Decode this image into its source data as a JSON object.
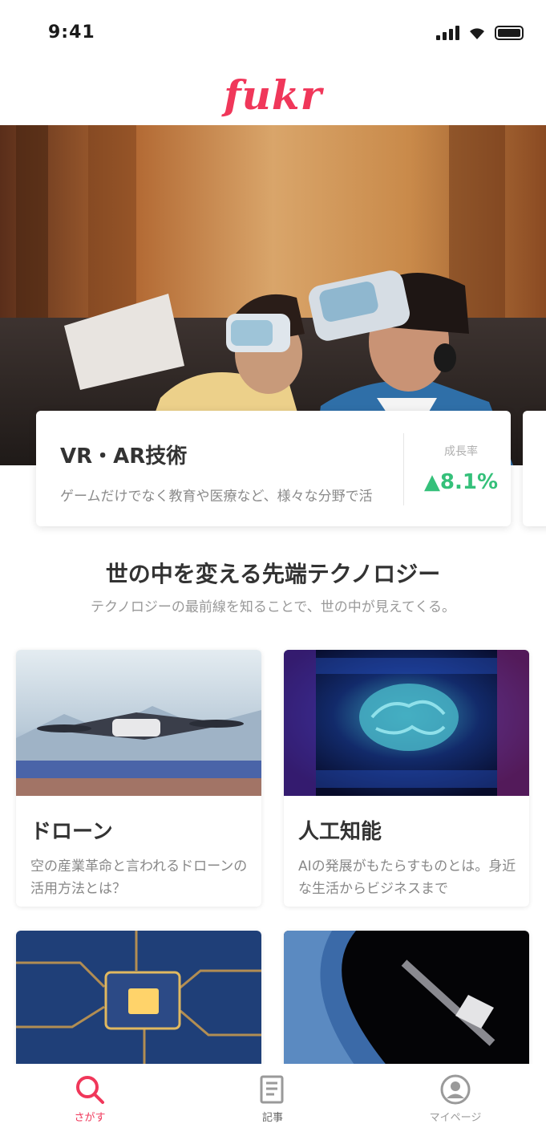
{
  "status_bar": {
    "time": "9:41"
  },
  "app": {
    "logo": "fukr"
  },
  "hero": {
    "card_title": "VR・AR技術",
    "card_description": "ゲームだけでなく教育や医療など、様々な分野で活用されている技術",
    "stat_label": "成長率",
    "stat_value": "▲8.1%"
  },
  "section": {
    "title": "世の中を変える先端テクノロジー",
    "subtitle": "テクノロジーの最前線を知ることで、世の中が見えてくる。"
  },
  "tiles": [
    {
      "title": "ドローン",
      "description": "空の産業革命と言われるドローンの活用方法とは？"
    },
    {
      "title": "人工知能",
      "description": "AIの発展がもたらすものとは。身近な生活からビジネスまで"
    },
    {
      "title": "",
      "description": ""
    },
    {
      "title": "",
      "description": ""
    }
  ],
  "tabbar": {
    "tabs": [
      {
        "label": "さがす",
        "icon": "search-icon"
      },
      {
        "label": "記事",
        "icon": "article-icon"
      },
      {
        "label": "マイページ",
        "icon": "user-icon"
      }
    ],
    "active_color": "#f0375a",
    "inactive_color": "#9a9a9a"
  }
}
